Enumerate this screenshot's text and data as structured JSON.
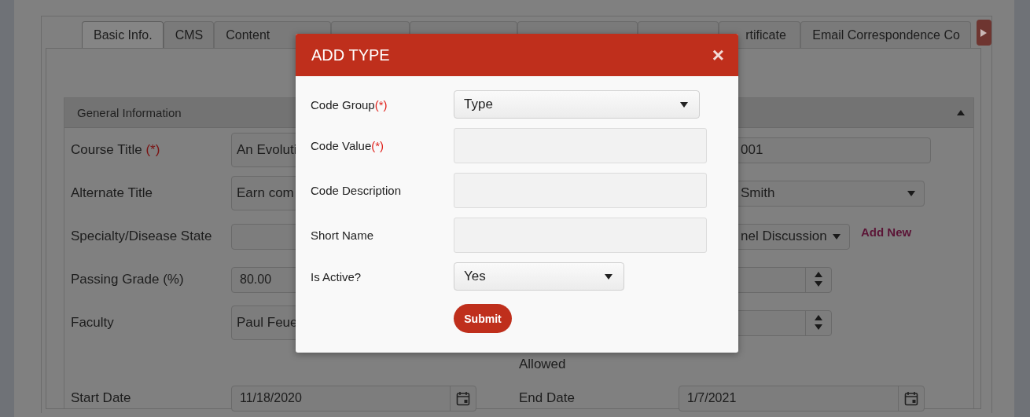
{
  "tabs": [
    {
      "label": "Basic Info.",
      "selected": true
    },
    {
      "label": "CMS",
      "selected": false
    },
    {
      "label": "Content",
      "selected": false
    },
    {
      "selected": false
    },
    {
      "selected": false
    },
    {
      "selected": false
    },
    {
      "selected": false
    },
    {
      "label": "rtificate",
      "selected": false
    },
    {
      "label": "Email Correspondence Co",
      "selected": false
    }
  ],
  "panel": {
    "title": "General Information",
    "expanded": true,
    "rows": [
      {
        "left": {
          "label": "Course Title",
          "required_mark": "(*)",
          "kind": "textarea",
          "value": "An Evoluti"
        },
        "right": {
          "kind": "text",
          "value": "001"
        }
      },
      {
        "left": {
          "label": "Alternate Title",
          "kind": "textarea",
          "value": "Earn com"
        },
        "right": {
          "kind": "select",
          "value": "Smith"
        }
      },
      {
        "left": {
          "label": "Specialty/Disease State",
          "kind": "text"
        },
        "right": {
          "kind": "select",
          "value": "nel Discussion",
          "link": "Add New"
        }
      },
      {
        "left": {
          "label": "Passing Grade (%)",
          "kind": "text",
          "value": "80.00"
        },
        "right": {
          "kind": "spinner"
        }
      },
      {
        "left": {
          "label": "Faculty",
          "kind": "textarea",
          "value": "Paul Feue"
        },
        "right": {
          "kind": "spinner"
        }
      },
      {
        "right": {
          "label": "Allowed"
        }
      },
      {
        "left": {
          "label": "Start Date",
          "kind": "date",
          "value": "11/18/2020"
        },
        "right": {
          "label": "End Date",
          "kind": "date",
          "value": "1/7/2021"
        }
      }
    ]
  },
  "modal": {
    "title": "ADD TYPE",
    "close": "×",
    "fields": [
      {
        "label": "Code Group",
        "required_mark": "(*)",
        "kind": "select",
        "value": "Type"
      },
      {
        "label": "Code Value",
        "required_mark": "(*)",
        "kind": "input"
      },
      {
        "label": "Code Description",
        "kind": "input"
      },
      {
        "label": "Short Name",
        "kind": "input"
      },
      {
        "label": "Is Active?",
        "kind": "select",
        "value": "Yes"
      }
    ],
    "submit": "Submit"
  }
}
